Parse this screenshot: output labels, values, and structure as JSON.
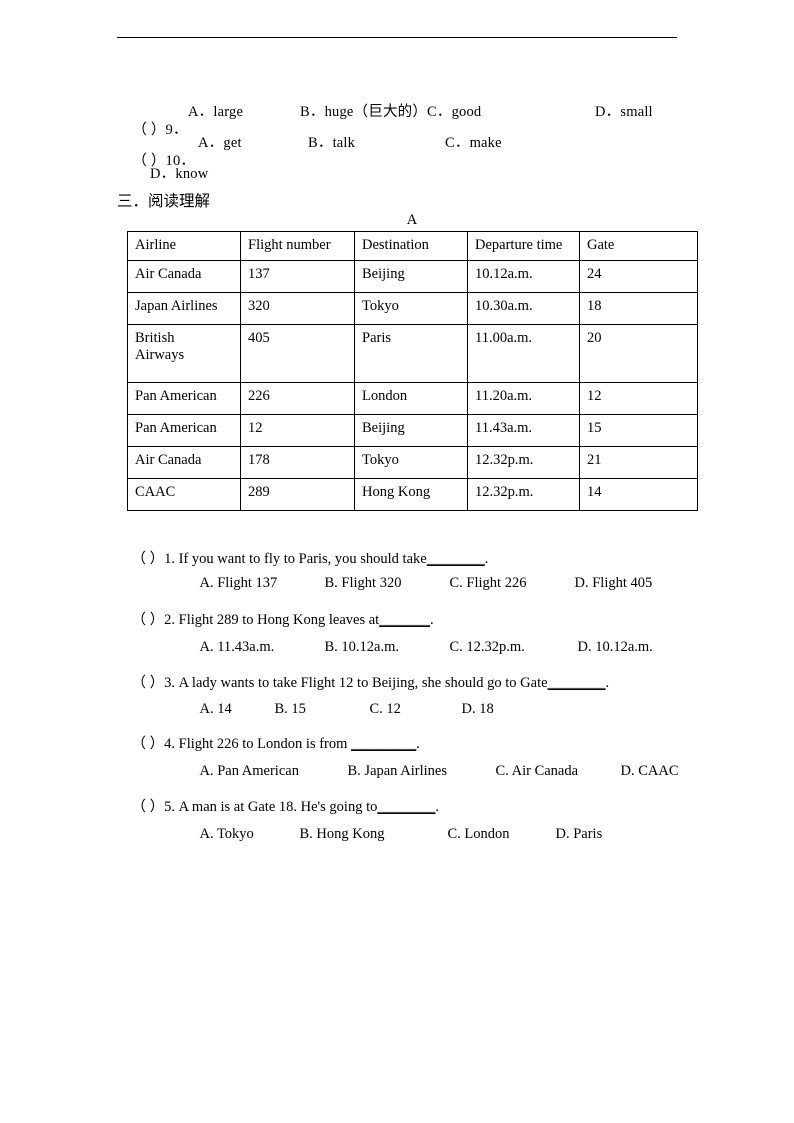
{
  "document": {
    "header_rule": true,
    "section_heading": "三．阅读理解",
    "passage_label": "A"
  },
  "cloze_items": [
    {
      "marker": "（ ）9．",
      "options": [
        {
          "label": "A．large"
        },
        {
          "label": "B．huge（巨大的）"
        },
        {
          "label": "C．good"
        },
        {
          "label": "D．small"
        }
      ]
    },
    {
      "marker": "（ ）10．",
      "options": [
        {
          "label": "A．get"
        },
        {
          "label": "B．talk"
        },
        {
          "label": "C．make"
        },
        {
          "label": "D．know"
        }
      ]
    }
  ],
  "flight_table": {
    "headers": [
      "Airline",
      "Flight number",
      "Destination",
      "Departure time",
      "Gate"
    ],
    "rows": [
      {
        "airline": "Air Canada",
        "flight_number": "137",
        "destination": "Beijing",
        "departure_time": "10.12a.m.",
        "gate": "24"
      },
      {
        "airline": "Japan Airlines",
        "flight_number": "320",
        "destination": "Tokyo",
        "departure_time": "10.30a.m.",
        "gate": "18"
      },
      {
        "airline": "British\nAirways",
        "flight_number": "405",
        "destination": "Paris",
        "departure_time": "11.00a.m.",
        "gate": "20"
      },
      {
        "airline": "Pan American",
        "flight_number": "226",
        "destination": "London",
        "departure_time": "11.20a.m.",
        "gate": "12"
      },
      {
        "airline": "Pan American",
        "flight_number": "12",
        "destination": "Beijing",
        "departure_time": "11.43a.m.",
        "gate": "15"
      },
      {
        "airline": "Air Canada",
        "flight_number": "178",
        "destination": "Tokyo",
        "departure_time": "12.32p.m.",
        "gate": "21"
      },
      {
        "airline": "CAAC",
        "flight_number": "289",
        "destination": "Hong Kong",
        "departure_time": "12.32p.m.",
        "gate": "14"
      }
    ]
  },
  "questions": [
    {
      "stem_before": "（ ）1. If you want to fly to Paris, you should take",
      "blank": "________",
      "stem_after": ".",
      "options": [
        "A. Flight 137",
        "B. Flight 320",
        "C. Flight 226",
        "D. Flight 405"
      ]
    },
    {
      "stem_before": "（ ）2. Flight 289 to Hong Kong leaves at",
      "blank": "_______",
      "stem_after": ".",
      "options": [
        "A. 11.43a.m.",
        "B. 10.12a.m.",
        "C. 12.32p.m.",
        "D. 10.12a.m."
      ]
    },
    {
      "stem_before": "（ ）3. A lady wants to take Flight 12 to Beijing, she should go to Gate",
      "blank": "________",
      "stem_after": ".",
      "options": [
        "A. 14",
        "B. 15",
        "C. 12",
        "D. 18"
      ]
    },
    {
      "stem_before": "（ ）4. Flight 226 to London is from ",
      "blank": "_________",
      "stem_after": ".",
      "options": [
        "A. Pan American",
        "B. Japan Airlines",
        "C. Air Canada",
        "D. CAAC"
      ]
    },
    {
      "stem_before": "（ ）5. A man is at Gate 18. He's going to",
      "blank": "________",
      "stem_after": ".",
      "options": [
        "A. Tokyo",
        "B. Hong Kong",
        "C. London",
        "D. Paris"
      ]
    }
  ]
}
